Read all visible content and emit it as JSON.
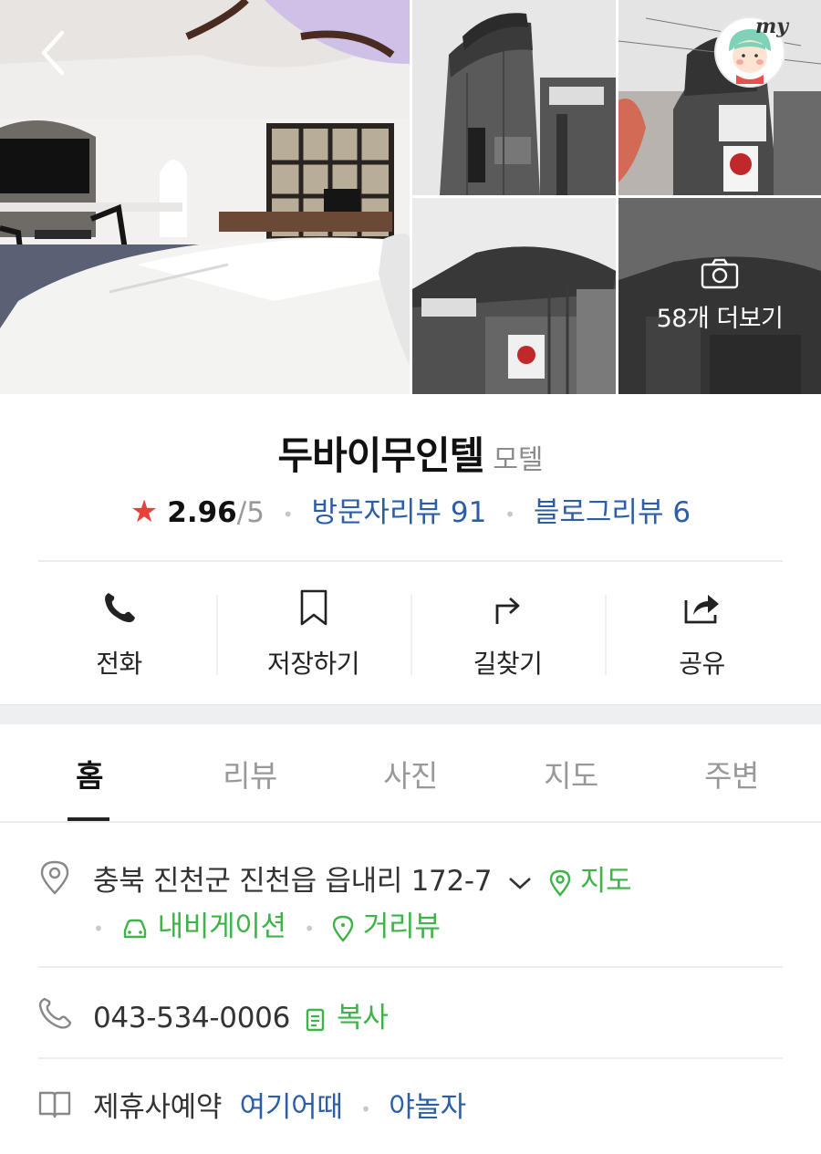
{
  "header": {
    "back_icon": "chevron-left-icon",
    "my_label": "my",
    "more_photos_label": "58개 더보기"
  },
  "place": {
    "name": "두바이무인텔",
    "category": "모텔",
    "rating": "2.96",
    "rating_max": "/5",
    "visitor_reviews": "방문자리뷰 91",
    "blog_reviews": "블로그리뷰 6"
  },
  "actions": [
    {
      "label": "전화",
      "icon": "phone-icon"
    },
    {
      "label": "저장하기",
      "icon": "bookmark-icon"
    },
    {
      "label": "길찾기",
      "icon": "directions-icon"
    },
    {
      "label": "공유",
      "icon": "share-icon"
    }
  ],
  "tabs": [
    {
      "label": "홈",
      "active": true
    },
    {
      "label": "리뷰",
      "active": false
    },
    {
      "label": "사진",
      "active": false
    },
    {
      "label": "지도",
      "active": false
    },
    {
      "label": "주변",
      "active": false
    }
  ],
  "address": {
    "text": "충북 진천군 진천읍 읍내리 172-7",
    "map_link": "지도",
    "navigation_link": "내비게이션",
    "streetview_link": "거리뷰"
  },
  "phone": {
    "number": "043-534-0006",
    "copy_label": "복사"
  },
  "booking": {
    "label": "제휴사예약",
    "partner_1": "여기어때",
    "partner_2": "야놀자"
  },
  "colors": {
    "link_blue": "#2c5ea8",
    "accent_green": "#3db348",
    "star_red": "#e8413b"
  }
}
